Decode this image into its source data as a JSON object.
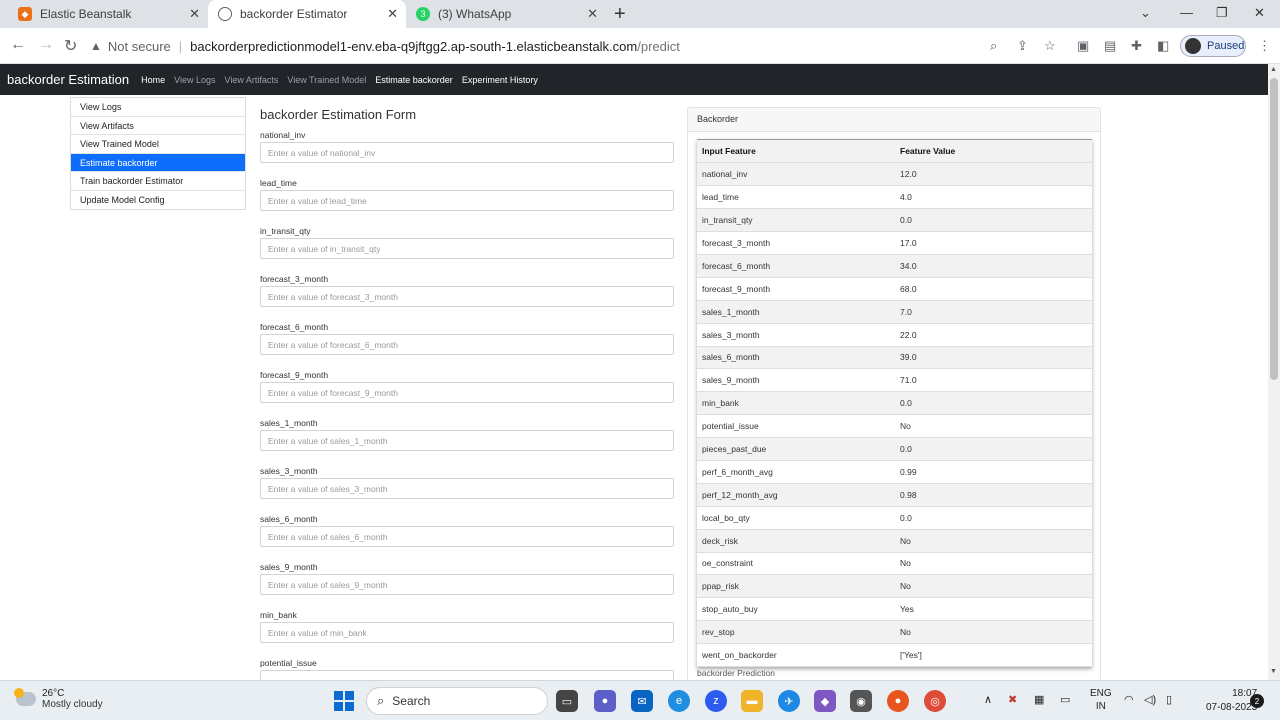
{
  "browser": {
    "tabs": [
      {
        "title": "Elastic Beanstalk"
      },
      {
        "title": "backorder Estimator"
      },
      {
        "title": "(3) WhatsApp"
      }
    ],
    "not_secure": "Not secure",
    "url_host": "backorderpredictionmodel1-env.eba-q9jftgg2.ap-south-1.elasticbeanstalk.com",
    "url_path": "/predict",
    "profile_status": "Paused"
  },
  "nav": {
    "brand": "backorder Estimation",
    "links": [
      "Home",
      "View Logs",
      "View Artifacts",
      "View Trained Model",
      "Estimate backorder",
      "Experiment History"
    ]
  },
  "sidebar": {
    "items": [
      "View Logs",
      "View Artifacts",
      "View Trained Model",
      "Estimate backorder",
      "Train backorder Estimator",
      "Update Model Config"
    ]
  },
  "form": {
    "title": "backorder Estimation Form",
    "fields": [
      {
        "label": "national_inv",
        "placeholder": "Enter a value of national_inv"
      },
      {
        "label": "lead_time",
        "placeholder": "Enter a value of lead_time"
      },
      {
        "label": "in_transit_qty",
        "placeholder": "Enter a value of in_transit_qty"
      },
      {
        "label": "forecast_3_month",
        "placeholder": "Enter a value of forecast_3_month"
      },
      {
        "label": "forecast_6_month",
        "placeholder": "Enter a value of forecast_6_month"
      },
      {
        "label": "forecast_9_month",
        "placeholder": "Enter a value of forecast_9_month"
      },
      {
        "label": "sales_1_month",
        "placeholder": "Enter a value of sales_1_month"
      },
      {
        "label": "sales_3_month",
        "placeholder": "Enter a value of sales_3_month"
      },
      {
        "label": "sales_6_month",
        "placeholder": "Enter a value of sales_6_month"
      },
      {
        "label": "sales_9_month",
        "placeholder": "Enter a value of sales_9_month"
      },
      {
        "label": "min_bank",
        "placeholder": "Enter a value of min_bank"
      },
      {
        "label": "potential_issue",
        "placeholder": ""
      }
    ]
  },
  "result": {
    "card_title": "Backorder",
    "headers": [
      "Input Feature",
      "Feature Value"
    ],
    "rows": [
      [
        "national_inv",
        "12.0"
      ],
      [
        "lead_time",
        "4.0"
      ],
      [
        "in_transit_qty",
        "0.0"
      ],
      [
        "forecast_3_month",
        "17.0"
      ],
      [
        "forecast_6_month",
        "34.0"
      ],
      [
        "forecast_9_month",
        "68.0"
      ],
      [
        "sales_1_month",
        "7.0"
      ],
      [
        "sales_3_month",
        "22.0"
      ],
      [
        "sales_6_month",
        "39.0"
      ],
      [
        "sales_9_month",
        "71.0"
      ],
      [
        "min_bank",
        "0.0"
      ],
      [
        "potential_issue",
        "No"
      ],
      [
        "pieces_past_due",
        "0.0"
      ],
      [
        "perf_6_month_avg",
        "0.99"
      ],
      [
        "perf_12_month_avg",
        "0.98"
      ],
      [
        "local_bo_qty",
        "0.0"
      ],
      [
        "deck_risk",
        "No"
      ],
      [
        "oe_constraint",
        "No"
      ],
      [
        "ppap_risk",
        "No"
      ],
      [
        "stop_auto_buy",
        "Yes"
      ],
      [
        "rev_stop",
        "No"
      ],
      [
        "went_on_backorder",
        "['Yes']"
      ]
    ],
    "prediction_label": "backorder Prediction"
  },
  "taskbar": {
    "temperature": "26°C",
    "weather": "Mostly cloudy",
    "search": "Search",
    "lang_top": "ENG",
    "lang_bottom": "IN",
    "time": "18:07",
    "date": "07-08-2023",
    "notifications": "2"
  }
}
